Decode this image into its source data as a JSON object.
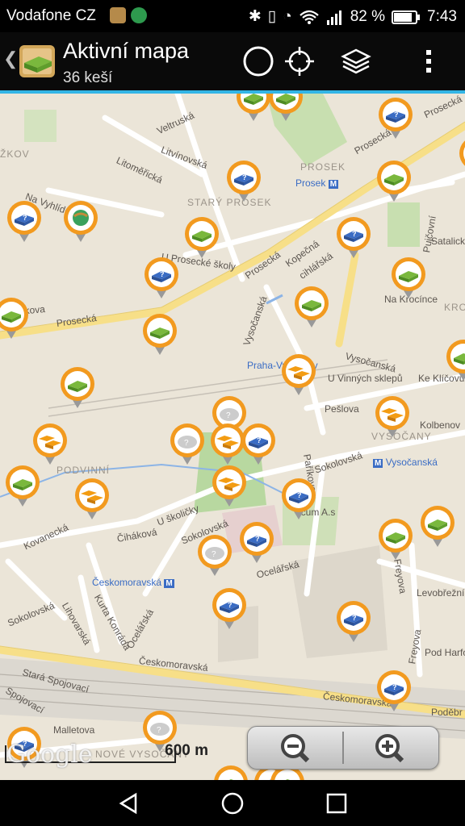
{
  "status_bar": {
    "carrier": "Vodafone CZ",
    "battery": "82 %",
    "time": "7:43",
    "icons": [
      "notification-app-icon",
      "hangouts-icon",
      "bluetooth-icon",
      "vibrate-icon",
      "alarm-icon",
      "wifi-icon",
      "signal-icon",
      "battery-icon"
    ]
  },
  "app_bar": {
    "title": "Aktivní mapa",
    "subtitle": "36 keší",
    "actions": [
      "circle-icon",
      "crosshair-icon",
      "layers-icon",
      "overflow-menu-icon"
    ]
  },
  "map": {
    "streets": {
      "vltruska": "Veltruská",
      "litvinovska": "Litvínovská",
      "litomericka": "Litoměřická",
      "na_vyhlidce": "Na Vyhlídce",
      "u_prosecke_skoly": "U Prosecké školy",
      "prosecka": "Prosecká",
      "prosecka2": "Prosecká",
      "prosecka3": "Prosecká",
      "prosecka4": "Prosecká",
      "kopecna": "Kopečná",
      "cihlarska": "cihlářská",
      "satalicka": "Satalick",
      "pujcovni": "Pujčovní",
      "na_krocince": "Na Krocínce",
      "vysocanska": "Vysočanská",
      "vysocanska2": "Vysočanská",
      "u_vinnych_sklepu": "U Vinných sklepů",
      "ke_klicovu": "Ke Klíčovu",
      "undrakova": "undrakova",
      "pesova": "Pešlova",
      "parikova": "Paříkova",
      "kolbenova": "Kolbenov",
      "sokolovska": "Sokolovská",
      "sokolovska2": "Sokolovská",
      "sokolovska3": "Sokolovská",
      "u_skolicky": "U školičky",
      "cihakova": "Čiháková",
      "kovanecka": "Kovanecká",
      "ocelarska": "Ocelářská",
      "ocelarska2": "Ocelářská",
      "kurta_konrada": "Kurta Konráda",
      "lihovarska": "Lihovarská",
      "levobrezni": "Levobřežní",
      "freyova": "Freyova",
      "freyova2": "Freyova",
      "pod_harfou": "Pod Harfou",
      "ceskomoravska": "Českomoravská",
      "ceskomoravska2": "Českomoravská",
      "podebr": "Poděbr",
      "stara_spojovaci": "Stará Spojovací",
      "spojovaci": "Spojovací",
      "malletova": "Malletova",
      "arena": "icum A.s"
    },
    "districts": {
      "stary_prosek": "STARÝ PROSEK",
      "prosek": "PROSEK",
      "podvinni": "PODVINNÍ",
      "vysocany": "VYSOČANY",
      "nove_vysocany": "NOVÉ VYSOČANY",
      "zizkov": "ŽKOV",
      "kro": "KRO"
    },
    "stations": {
      "prosek": "Prosek",
      "praha_vysocany": "Praha-Vysočany",
      "vysocanska": "Vysočanská",
      "ceskomoravska": "Českomoravská"
    },
    "scale": "600 m",
    "attribution": "Google",
    "zoom_out": "minus-zoom-icon",
    "zoom_in": "plus-zoom-icon"
  },
  "nav_bar": [
    "back-icon",
    "home-icon",
    "recents-icon"
  ],
  "colors": {
    "accent": "#33b5e5",
    "marker_ring": "#f29a1f",
    "traditional": "#7ab83d",
    "mystery": "#3a6cc4",
    "multi": "#f39c12"
  }
}
